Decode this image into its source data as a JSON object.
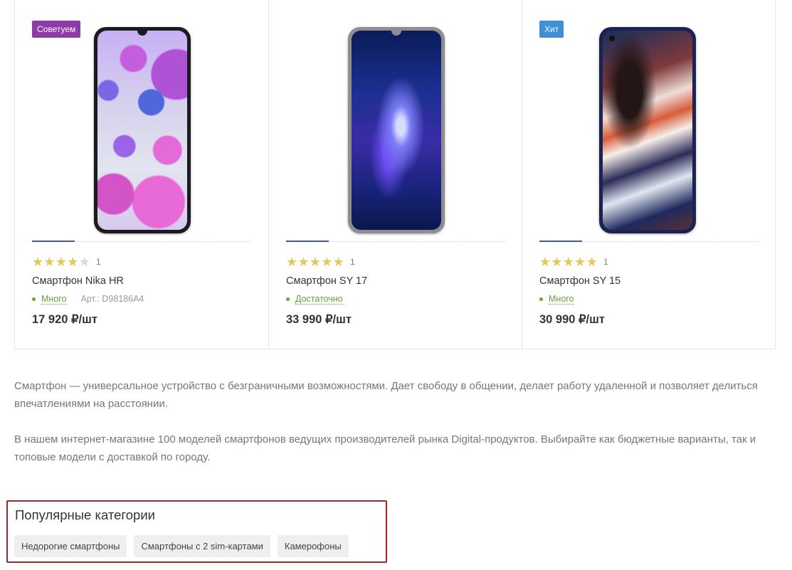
{
  "products": [
    {
      "badge": "Советуем",
      "badge_color": "#8e3aa8",
      "rating": 4,
      "rating_max": 5,
      "stars": [
        "★",
        "★",
        "★",
        "★",
        "★"
      ],
      "reviews": "1",
      "title": "Смартфон Nika HR",
      "stock": "Много",
      "sku": "Арт.: D98186A4",
      "price": "17 920 ₽/шт",
      "gallery_slides": 5,
      "gallery_active": 1
    },
    {
      "badge": null,
      "rating": 5,
      "rating_max": 5,
      "stars": [
        "★",
        "★",
        "★",
        "★",
        "★"
      ],
      "reviews": "1",
      "title": "Смартфон SY 17",
      "stock": "Достаточно",
      "sku": null,
      "price": "33 990 ₽/шт",
      "gallery_slides": 5,
      "gallery_active": 1
    },
    {
      "badge": "Хит",
      "badge_color": "#3f8fd6",
      "rating": 5,
      "rating_max": 5,
      "stars": [
        "★",
        "★",
        "★",
        "★",
        "★"
      ],
      "reviews": "1",
      "title": "Смартфон SY 15",
      "stock": "Много",
      "sku": null,
      "price": "30 990 ₽/шт",
      "gallery_slides": 5,
      "gallery_active": 1
    }
  ],
  "colors": {
    "star_on": "#e7c65a",
    "star_off": "#d9d9d9",
    "in_stock": "#6aa03a",
    "gallery_active": "#3f5b94",
    "popular_border": "#a12828"
  },
  "description": {
    "p1": "Смартфон — универсальное устройство с безграничными возможностями. Дает свободу в общении, делает работу удаленной и позволяет делиться впечатлениями на расстоянии.",
    "p2": "В нашем интернет-магазине 100 моделей смартфонов ведущих производителей рынка Digital-продуктов. Выбирайте как бюджетные варианты, так и топовые модели с доставкой по городу."
  },
  "popular": {
    "title": "Популярные категории",
    "chips": [
      "Недорогие смартфоны",
      "Смартфоны с 2 sim-картами",
      "Камерофоны"
    ]
  }
}
